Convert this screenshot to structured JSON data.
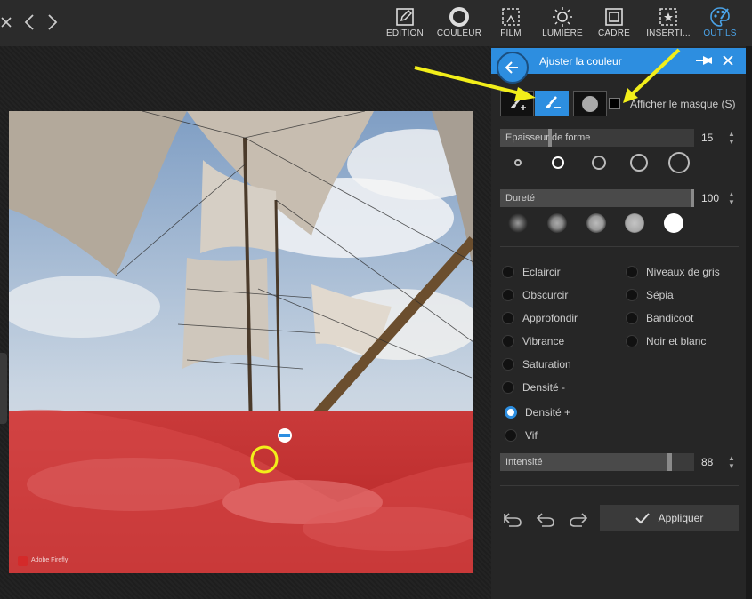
{
  "toolbar": {
    "tools": [
      {
        "label": "EDITION",
        "icon": "edit-icon"
      },
      {
        "label": "COULEUR",
        "icon": "color-circle-icon"
      },
      {
        "label": "FILM",
        "icon": "film-icon"
      },
      {
        "label": "LUMIÈRE",
        "icon": "sun-icon"
      },
      {
        "label": "CADRE",
        "icon": "frame-icon"
      },
      {
        "label": "INSERTI...",
        "icon": "insert-star-icon"
      },
      {
        "label": "OUTILS",
        "icon": "palette-icon"
      }
    ],
    "active_tool": "OUTILS"
  },
  "photo": {
    "watermark": "Adobe Firefly"
  },
  "panel": {
    "title": "Ajuster la couleur",
    "show_mask_label": "Afficher le masque (S)",
    "brush_size": {
      "label": "Epaisseur de forme",
      "value": "15",
      "level": 0.25
    },
    "hardness": {
      "label": "Dureté",
      "value": "100",
      "level": 1.0
    },
    "effects_left": [
      "Eclaircir",
      "Obscurcir",
      "Approfondir",
      "Vibrance",
      "Saturation",
      "Densité -",
      "Densité +",
      "Vif"
    ],
    "effects_right": [
      "Niveaux de gris",
      "Sépia",
      "Bandicoot",
      "Noir et blanc"
    ],
    "selected_effect": "Densité +",
    "intensity": {
      "label": "Intensité",
      "value": "88",
      "level": 0.88
    },
    "apply_label": "Appliquer"
  },
  "colors": {
    "accent": "#2d8ee0",
    "mask_red": "#d42a2a",
    "annotation": "#f2ee1a"
  }
}
